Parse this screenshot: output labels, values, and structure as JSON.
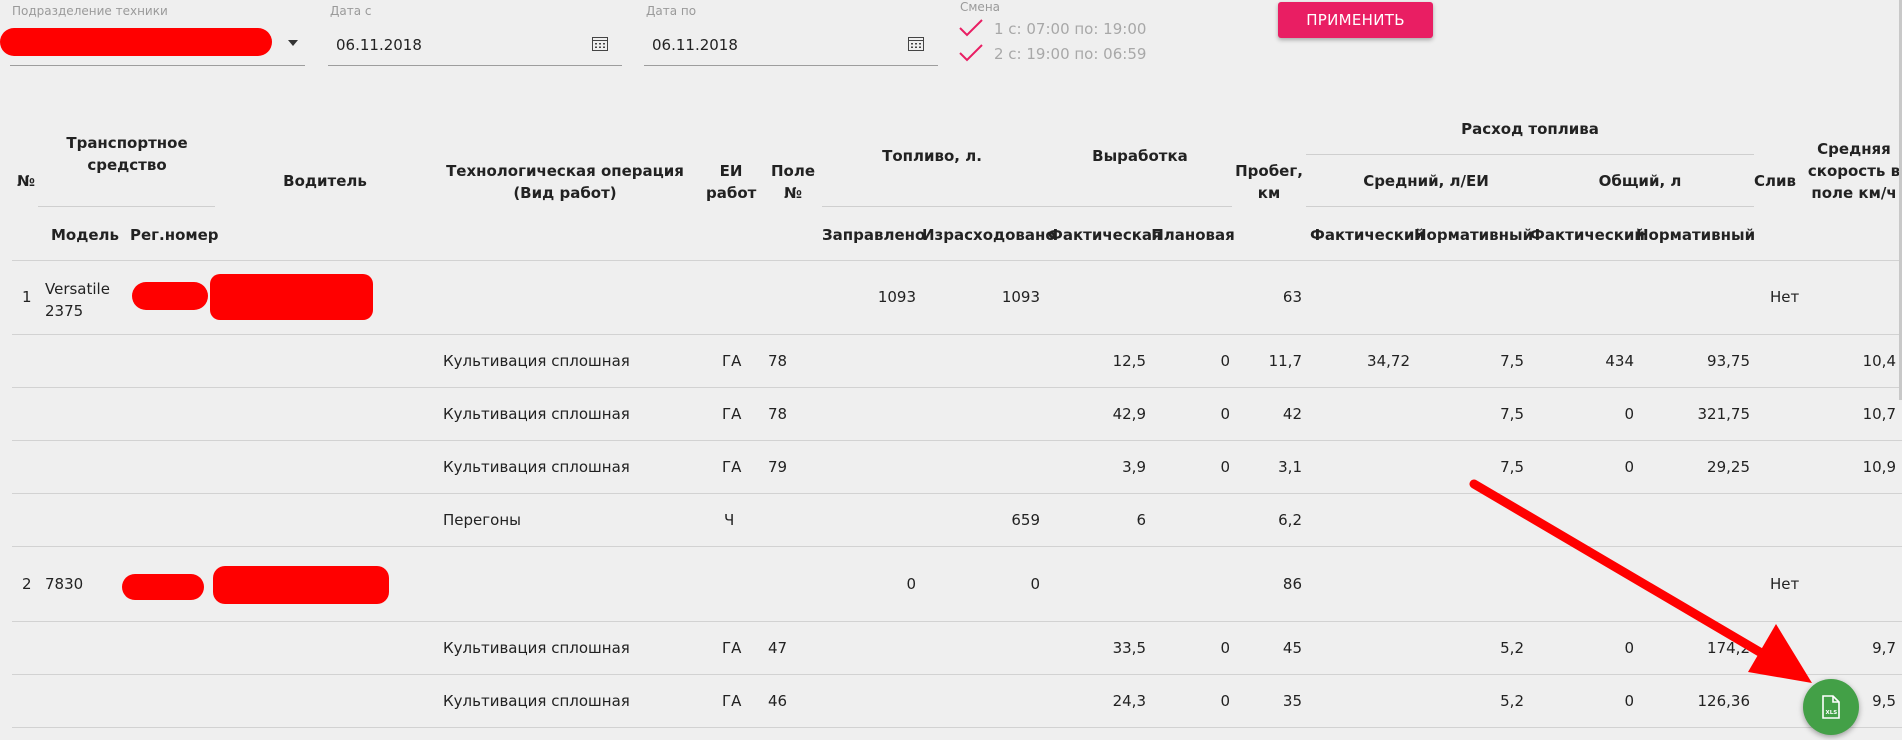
{
  "filters": {
    "subdivision_label": "Подразделение техники",
    "date_from_label": "Дата с",
    "date_from_value": "06.11.2018",
    "date_to_label": "Дата по",
    "date_to_value": "06.11.2018",
    "shift_label": "Смена",
    "shift_options": [
      "1 с: 07:00 по: 19:00",
      "2 с: 19:00 по: 06:59"
    ],
    "apply_label": "ПРИМЕНИТЬ"
  },
  "header": {
    "num": "№",
    "vehicle": "Транспортное средство",
    "model": "Модель",
    "reg": "Рег.номер",
    "driver": "Водитель",
    "operation": "Технологическая операция (Вид работ)",
    "unit": "ЕИ работ",
    "field": "Поле №",
    "fuel": "Топливо, л.",
    "refueled": "Заправлено",
    "consumed": "Израсходовано",
    "output": "Выработка",
    "actual": "Фактическая",
    "planned": "Плановая",
    "mileage": "Пробег, км",
    "fuel_consumption": "Расход топлива",
    "avg": "Средний, л/ЕИ",
    "total": "Общий, л",
    "fact": "Фактический",
    "norm": "Нормативный",
    "drain": "Слив",
    "speed": "Средняя скорость в поле км/ч"
  },
  "rows": [
    {
      "num": "1",
      "model": "Versatile 2375",
      "refueled": "1093",
      "consumed": "1093",
      "mileage": "63",
      "drain": "Нет"
    },
    {
      "op": "Культивация сплошная",
      "unit": "ГА",
      "field": "78",
      "out_fact": "12,5",
      "out_plan": "0",
      "mileage": "11,7",
      "avg_fact": "34,72",
      "avg_norm": "7,5",
      "tot_fact": "434",
      "tot_norm": "93,75",
      "speed": "10,4"
    },
    {
      "op": "Культивация сплошная",
      "unit": "ГА",
      "field": "78",
      "out_fact": "42,9",
      "out_plan": "0",
      "mileage": "42",
      "avg_norm": "7,5",
      "tot_fact": "0",
      "tot_norm": "321,75",
      "speed": "10,7"
    },
    {
      "op": "Культивация сплошная",
      "unit": "ГА",
      "field": "79",
      "out_fact": "3,9",
      "out_plan": "0",
      "mileage": "3,1",
      "avg_norm": "7,5",
      "tot_fact": "0",
      "tot_norm": "29,25",
      "speed": "10,9"
    },
    {
      "op": "Перегоны",
      "unit": "Ч",
      "consumed": "659",
      "out_fact": "6",
      "mileage": "6,2"
    },
    {
      "num": "2",
      "model": "7830",
      "refueled": "0",
      "consumed": "0",
      "mileage": "86",
      "drain": "Нет"
    },
    {
      "op": "Культивация сплошная",
      "unit": "ГА",
      "field": "47",
      "out_fact": "33,5",
      "out_plan": "0",
      "mileage": "45",
      "avg_norm": "5,2",
      "tot_fact": "0",
      "tot_norm": "174,2",
      "speed": "9,7"
    },
    {
      "op": "Культивация сплошная",
      "unit": "ГА",
      "field": "46",
      "out_fact": "24,3",
      "out_plan": "0",
      "mileage": "35",
      "avg_norm": "5,2",
      "tot_fact": "0",
      "tot_norm": "126,36",
      "speed": "9,5"
    }
  ],
  "colors": {
    "accent": "#e91e63",
    "check": "#e91e63",
    "fab": "#43a047",
    "redaction": "#ff0000"
  },
  "icons": {
    "calendar": "calendar-icon",
    "check": "check-icon",
    "dropdown": "chevron-down-icon",
    "xls": "xls-file-icon"
  }
}
